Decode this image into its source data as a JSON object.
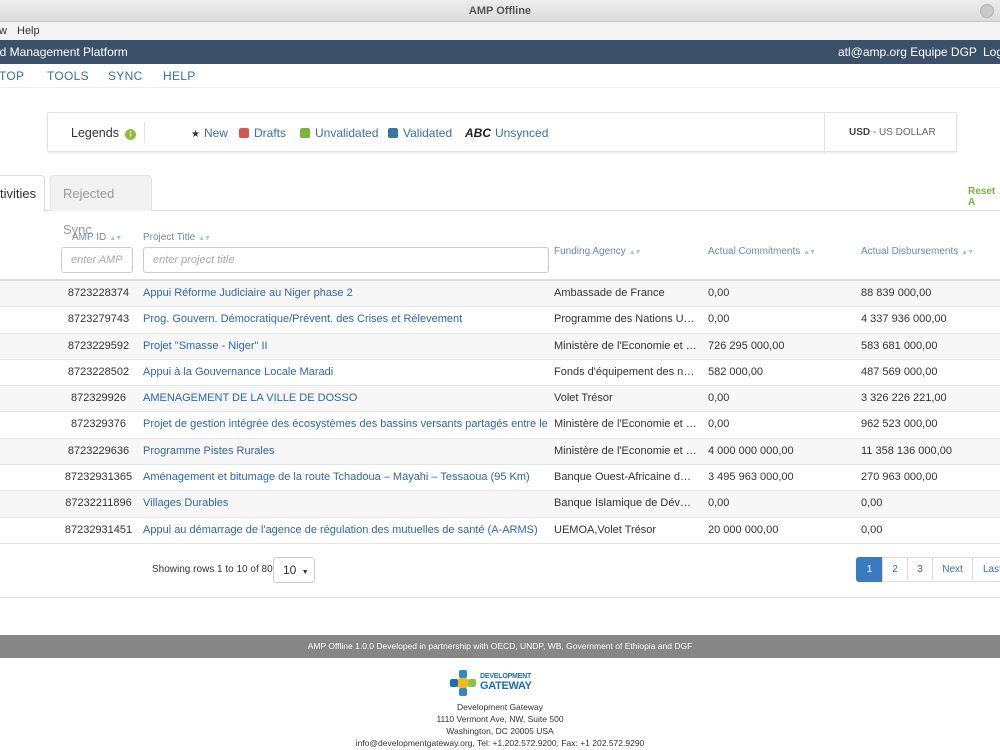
{
  "window": {
    "title": "AMP Offline"
  },
  "menu": {
    "items": [
      "w",
      "Help"
    ]
  },
  "header": {
    "app_name": "id Management Platform",
    "user": "atl@amp.org Equipe DGP",
    "logout": "Log"
  },
  "nav": {
    "items": [
      "TOP",
      "TOOLS",
      "SYNC",
      "HELP"
    ]
  },
  "legend": {
    "title": "Legends",
    "new": "New",
    "drafts": "Drafts",
    "unvalidated": "Unvalidated",
    "validated": "Validated",
    "unsynced_abbr": "ABC",
    "unsynced": "Unsynced",
    "currency_code": "USD",
    "currency_name": " - US DOLLAR",
    "colors": {
      "drafts": "#d9534f",
      "unvalidated": "#7cb53a",
      "validated": "#3a75a8"
    }
  },
  "tabs": {
    "activities": "tivities",
    "rejected": "Rejected Sync",
    "reset": "Reset A"
  },
  "table": {
    "headers": {
      "amp_id": "AMP ID",
      "title": "Project Title",
      "agency": "Funding Agency",
      "commitments": "Actual Commitments",
      "disbursements": "Actual Disbursements"
    },
    "filters": {
      "amp_id_placeholder": "enter AMP",
      "title_placeholder": "enter project title"
    },
    "rows": [
      {
        "id": "8723228374",
        "title": "Appui Réforme Judiciaire au Niger phase 2",
        "agency": "Ambassade de France",
        "commitments": "0,00",
        "disbursements": "88 839 000,00"
      },
      {
        "id": "8723279743",
        "title": "Prog. Gouvern. Démocratique/Prévent. des Crises et Rélevement",
        "agency": "Programme des Nations Unies ...",
        "commitments": "0,00",
        "disbursements": "4 337 936 000,00"
      },
      {
        "id": "8723229592",
        "title": "Projet \"Smasse - Niger\" II",
        "agency": "Ministère de l'Economie et des ...",
        "commitments": "726 295 000,00",
        "disbursements": "583 681 000,00"
      },
      {
        "id": "8723228502",
        "title": "Appui à la Gouvernance Locale Maradi",
        "agency": "Fonds d'équipement des nation...",
        "commitments": "582 000,00",
        "disbursements": "487 569 000,00"
      },
      {
        "id": "872329926",
        "title": "AMENAGEMENT DE LA VILLE DE DOSSO",
        "agency": "Volet Trésor",
        "commitments": "0,00",
        "disbursements": "3 326 226 221,00"
      },
      {
        "id": "872329376",
        "title": "Projet de gestion intégrée des écosystèmes des bassins versants partagés entre le Niger-Nigeria",
        "agency": "Ministère de l'Economie et des ...",
        "commitments": "0,00",
        "disbursements": "962 523 000,00"
      },
      {
        "id": "8723229636",
        "title": "Programme Pistes Rurales",
        "agency": "Ministère de l'Economie et des ...",
        "commitments": "4 000 000 000,00",
        "disbursements": "11 358 136 000,00"
      },
      {
        "id": "87232931365",
        "title": "Aménagement et bitumage de la route Tchadoua – Mayahi – Tessaoua (95 Km)",
        "agency": "Banque Ouest-Africaine de Dév...",
        "commitments": "3 495 963 000,00",
        "disbursements": "270 963 000,00"
      },
      {
        "id": "87232211896",
        "title": "Villages Durables",
        "agency": "Banque Islamique de Développ...",
        "commitments": "0,00",
        "disbursements": "0,00"
      },
      {
        "id": "87232931451",
        "title": "Appui au démarrage de l'agence de régulation des mutuelles de santé (A-ARMS)",
        "agency": "UEMOA,Volet Trésor",
        "commitments": "20 000 000,00",
        "disbursements": "0,00"
      }
    ]
  },
  "pager": {
    "info": "Showing rows 1 to 10 of 803",
    "page_size": "10",
    "pages": [
      "1",
      "2",
      "3"
    ],
    "next": "Next",
    "last": "Last"
  },
  "footer": {
    "credit": "AMP Offline 1.0.0 Developed in partnership with OECD, UNDP, WB, Government of Ethiopia and DGF",
    "logo_line1": "DEVELOPMENT",
    "logo_line2": "GATEWAY",
    "org": "Development Gateway",
    "address1": "1110 Vermont Ave, NW, Suite 500",
    "address2": "Washington, DC 20005 USA",
    "contact": "info@developmentgateway.org, Tel: +1.202.572.9200, Fax: +1 202.572.9290"
  }
}
